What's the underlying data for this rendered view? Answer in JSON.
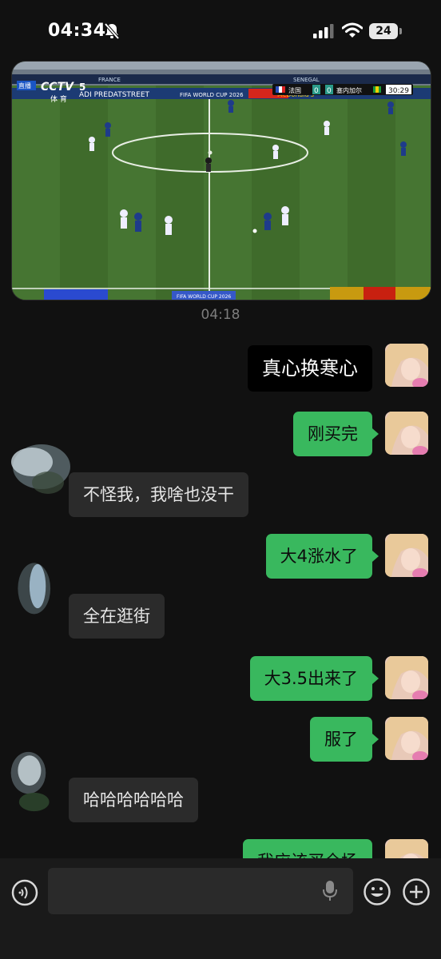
{
  "status_bar": {
    "time": "04:34",
    "battery": "24",
    "icons": [
      "bell-muted-icon",
      "signal-icon",
      "wifi-icon",
      "battery-icon"
    ]
  },
  "video": {
    "channel": "CCTV",
    "channel_num": "5",
    "channel_sub": "体 育",
    "live_tag": "直播",
    "team_home": "法国",
    "team_away": "塞内加尔",
    "score_home": "0",
    "score_away": "0",
    "clock": "30:29",
    "banner_left": "FRANCE",
    "banner_right": "SENEGAL",
    "ad_text": "ADI PREDATSTREET",
    "ad_fifa": "FIFA WORLD CUP 2026",
    "ad_bottom": "FIFA WORLD CUP 2026",
    "ad_mcd": "McDonald's"
  },
  "chat": {
    "timestamp": "04:18",
    "messages": [
      {
        "side": "me",
        "style": "black",
        "text": "真心换寒心"
      },
      {
        "side": "me",
        "style": "green",
        "text": "刚买完"
      },
      {
        "side": "other",
        "text": "不怪我，我啥也没干"
      },
      {
        "side": "me",
        "style": "green",
        "text": "大4涨水了"
      },
      {
        "side": "other",
        "text": "全在逛街"
      },
      {
        "side": "me",
        "style": "green",
        "text": "大3.5出来了"
      },
      {
        "side": "me",
        "style": "green",
        "text": "服了"
      },
      {
        "side": "other",
        "text": "哈哈哈哈哈哈"
      },
      {
        "side": "me",
        "style": "green",
        "text": "我应该买全场"
      }
    ]
  },
  "input_bar": {
    "placeholder": "",
    "icons": [
      "voice-icon",
      "mic-icon",
      "emoji-icon",
      "plus-icon"
    ]
  },
  "colors": {
    "bubble_green": "#39b85e",
    "bubble_grey": "#2b2b2b",
    "background": "#111111"
  }
}
